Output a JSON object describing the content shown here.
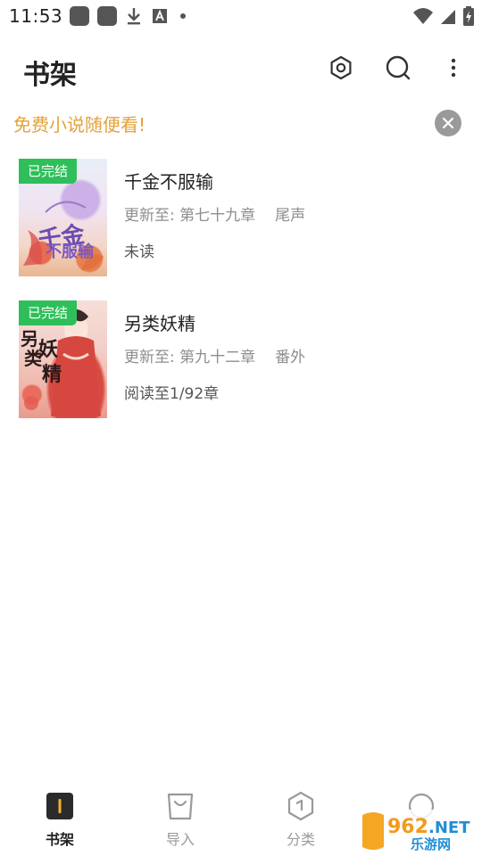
{
  "status_bar": {
    "time": "11:53",
    "icons": [
      "app-icon",
      "app-icon",
      "download-icon",
      "font-icon",
      "dot-icon",
      "wifi-icon",
      "signal-icon",
      "battery-icon"
    ]
  },
  "header": {
    "title": "书架",
    "actions": [
      "settings-icon",
      "search-icon",
      "more-icon"
    ]
  },
  "banner": {
    "text": "免费小说随便看!"
  },
  "books": [
    {
      "badge": "已完结",
      "title": "千金不服输",
      "update_prefix": "更新至: 第七十九章",
      "chapter_name": "尾声",
      "progress": "未读",
      "cover_text": "千金不服输"
    },
    {
      "badge": "已完结",
      "title": "另类妖精",
      "update_prefix": "更新至: 第九十二章",
      "chapter_name": "番外",
      "progress": "阅读至1/92章",
      "cover_text": "另类妖精"
    }
  ],
  "bottom_nav": {
    "items": [
      {
        "label": "书架",
        "active": true,
        "icon": "bookshelf-icon"
      },
      {
        "label": "导入",
        "active": false,
        "icon": "import-bag-icon"
      },
      {
        "label": "分类",
        "active": false,
        "icon": "category-hexagon-icon"
      },
      {
        "label": "",
        "active": false,
        "icon": "discover-icon"
      }
    ]
  },
  "watermark": {
    "logo_text": "962.NET",
    "sub_text": "乐游网"
  },
  "colors": {
    "accent": "#e3a23b",
    "badge_green": "#2fbf5a",
    "muted_text": "#8e8e8e"
  }
}
